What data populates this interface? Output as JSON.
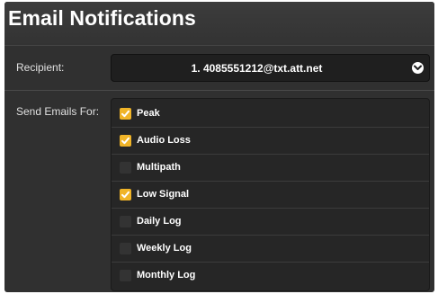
{
  "title": "Email Notifications",
  "recipient": {
    "label": "Recipient:",
    "selected_value": "1. 4085551212@txt.att.net",
    "dropdown_icon": "chevron-down-icon"
  },
  "send_emails_for": {
    "label": "Send Emails For:",
    "items": [
      {
        "label": "Peak",
        "checked": true
      },
      {
        "label": "Audio Loss",
        "checked": true
      },
      {
        "label": "Multipath",
        "checked": false
      },
      {
        "label": "Low Signal",
        "checked": true
      },
      {
        "label": "Daily Log",
        "checked": false
      },
      {
        "label": "Weekly Log",
        "checked": false
      },
      {
        "label": "Monthly Log",
        "checked": false
      }
    ]
  },
  "colors": {
    "checkbox_checked": "#f0b428",
    "panel_background": "#303030"
  }
}
